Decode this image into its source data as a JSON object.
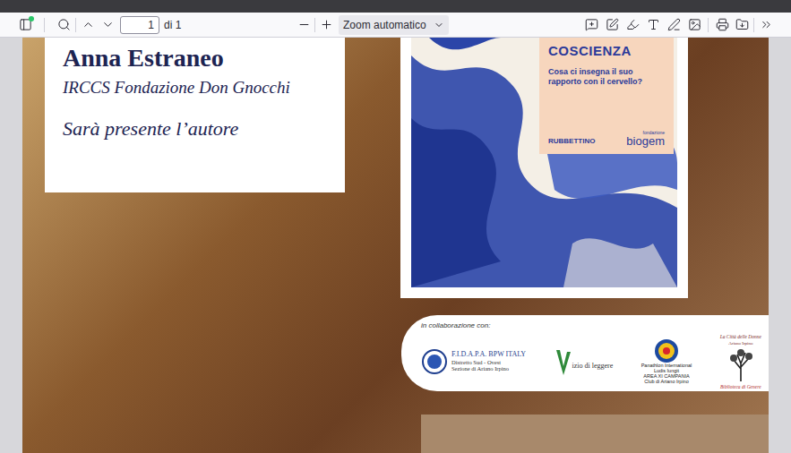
{
  "toolbar": {
    "sidebar_notification": true,
    "page_input": "1",
    "page_count": "di 1",
    "zoom": "Zoom automatico"
  },
  "document": {
    "author": "Anna Estraneo",
    "affiliation": "IRCCS Fondazione Don Gnocchi",
    "note": "Sarà presente l’autore",
    "book": {
      "title": "COSCIENZA",
      "subtitle": "Cosa ci insegna il suo rapporto con il cervello?",
      "publisher": "RUBBETTINO",
      "foundation_label": "fondazione",
      "foundation": "biogem"
    },
    "collaboration": {
      "label": "in collaborazione con:",
      "partners": [
        {
          "kind": "fidapa",
          "name": "F.I.D.A.P.A. BPW ITALY",
          "lines": [
            "Distretto Sud - Ovest",
            "Sezione di Ariano Irpino"
          ]
        },
        {
          "kind": "vizio",
          "name": "izio di leggere",
          "lines": []
        },
        {
          "kind": "panathlon",
          "name": "Panathlon International",
          "lines": [
            "Ludis Iungit",
            "AREA XI CAMPANIA",
            "Club di Ariano Irpino"
          ]
        },
        {
          "kind": "citta",
          "name": "La Città delle Donne",
          "lines": [
            "Ariano Irpino",
            "Biblioteca di Genere"
          ]
        }
      ]
    }
  }
}
